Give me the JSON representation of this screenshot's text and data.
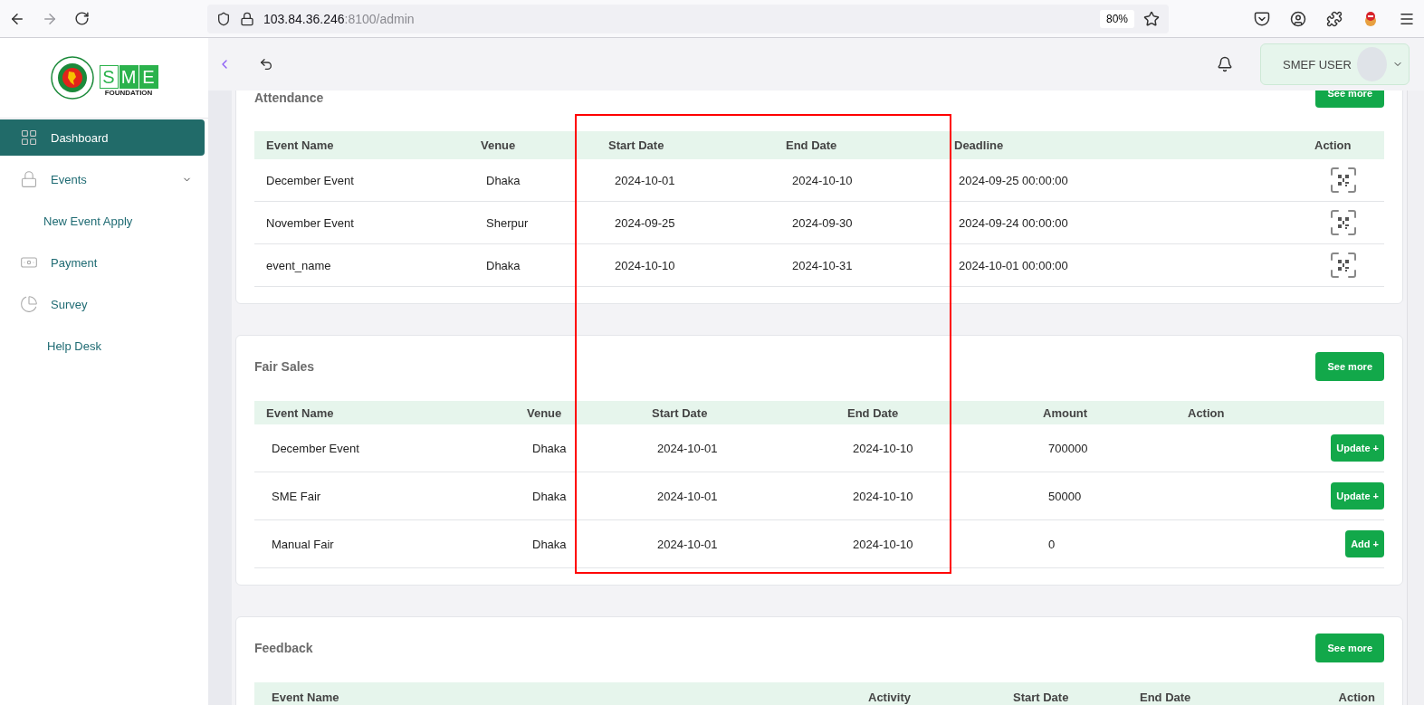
{
  "browser": {
    "url_host": "103.84.36.246",
    "url_path": ":8100/admin",
    "zoom": "80%"
  },
  "logo": {
    "letters": [
      "S",
      "M",
      "E"
    ],
    "subtitle": "FOUNDATION"
  },
  "sidebar": {
    "items": [
      {
        "label": "Dashboard",
        "selected": true
      },
      {
        "label": "Events",
        "selected": false,
        "expanded": true,
        "children": [
          {
            "label": "New Event Apply",
            "selected": false
          }
        ]
      },
      {
        "label": "Payment",
        "selected": false
      },
      {
        "label": "Survey",
        "selected": false
      },
      {
        "label": "Help Desk",
        "selected": false
      }
    ]
  },
  "user": {
    "name": "SMEF USER"
  },
  "attendance": {
    "title": "Attendance",
    "button": "See more",
    "columns": [
      "Event Name",
      "Venue",
      "Start Date",
      "End Date",
      "Deadline",
      "Action"
    ],
    "rows": [
      [
        "December Event",
        "Dhaka",
        "2024-10-01",
        "2024-10-10",
        "2024-09-25 00:00:00"
      ],
      [
        "November Event",
        "Sherpur",
        "2024-09-25",
        "2024-09-30",
        "2024-09-24 00:00:00"
      ],
      [
        "event_name",
        "Dhaka",
        "2024-10-10",
        "2024-10-31",
        "2024-10-01 00:00:00"
      ]
    ]
  },
  "fair_sales": {
    "title": "Fair Sales",
    "button": "See more",
    "columns": [
      "Event Name",
      "Venue",
      "Start Date",
      "End Date",
      "Amount",
      "Action"
    ],
    "rows": [
      {
        "cells": [
          "December Event",
          "Dhaka",
          "2024-10-01",
          "2024-10-10",
          "700000"
        ],
        "action": "Update +"
      },
      {
        "cells": [
          "SME Fair",
          "Dhaka",
          "2024-10-01",
          "2024-10-10",
          "50000"
        ],
        "action": "Update +"
      },
      {
        "cells": [
          "Manual Fair",
          "Dhaka",
          "2024-10-01",
          "2024-10-10",
          "0"
        ],
        "action": "Add +"
      }
    ]
  },
  "feedback": {
    "title": "Feedback",
    "button": "See more",
    "columns": [
      "Event Name",
      "Activity",
      "Start Date",
      "End Date",
      "Action"
    ]
  }
}
